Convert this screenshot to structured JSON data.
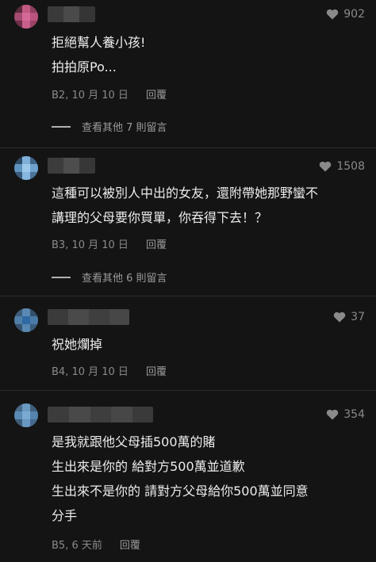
{
  "comments": [
    {
      "likes": "902",
      "lines": [
        "拒絕幫人養小孩!",
        "拍拍原Po..."
      ],
      "floor_time": "B2, 10 月 10 日",
      "reply_label": "回覆",
      "more_replies": "查看其他 7 則留言"
    },
    {
      "likes": "1508",
      "lines": [
        "這種可以被別人中出的女友，還附帶她那野蠻不",
        "講理的父母要你買單，你吞得下去！？"
      ],
      "floor_time": "B3, 10 月 10 日",
      "reply_label": "回覆",
      "more_replies": "查看其他 6 則留言"
    },
    {
      "likes": "37",
      "lines": [
        "祝她爛掉"
      ],
      "floor_time": "B4, 10 月 10 日",
      "reply_label": "回覆"
    },
    {
      "likes": "354",
      "lines": [
        "是我就跟他父母插500萬的賭",
        "生出來是你的 給對方500萬並道歉",
        "生出來不是你的  請對方父母給你500萬並同意",
        "分手"
      ],
      "floor_time": "B5, 6 天前",
      "reply_label": "回覆"
    }
  ],
  "colors": {
    "background": "#141414",
    "text": "#ececec",
    "muted": "#8a8a8a",
    "divider": "#2c2c2c"
  },
  "icons": {
    "like": "heart-icon",
    "more_replies": "dash-line-icon"
  }
}
